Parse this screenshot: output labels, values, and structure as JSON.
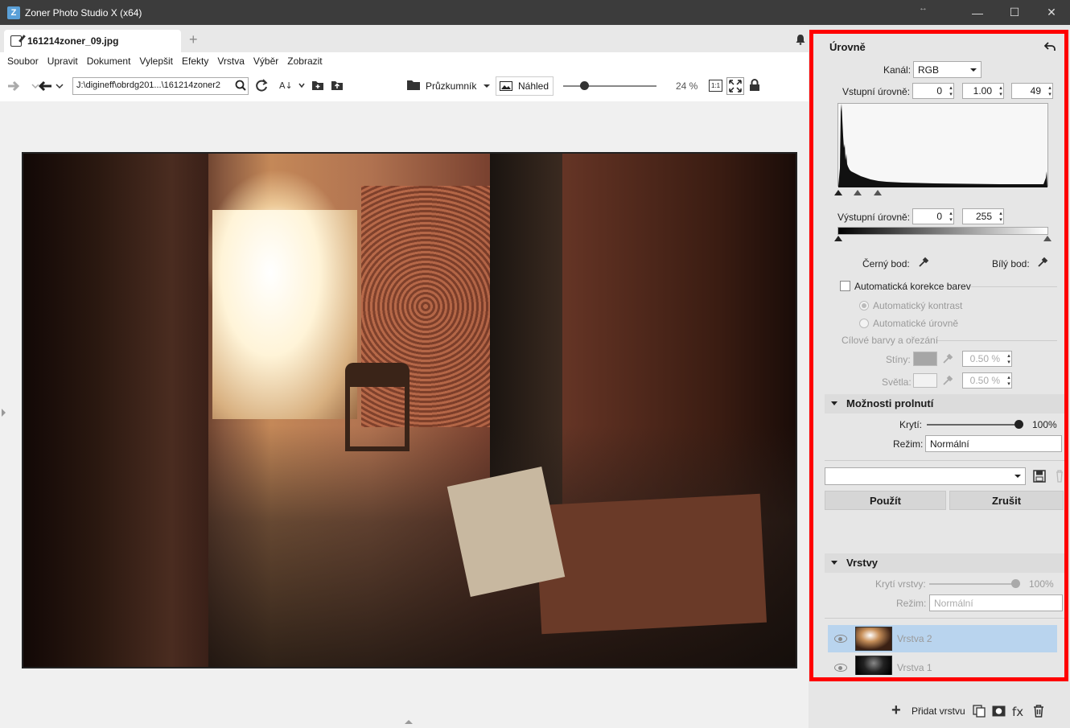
{
  "window": {
    "title": "Zoner Photo Studio X (x64)",
    "app_icon": "Z",
    "resize_glyph": "↔",
    "minimize": "—",
    "maximize": "☐",
    "close": "✕"
  },
  "tab": {
    "filename": "161214zoner_09.jpg",
    "new_tab": "+"
  },
  "menu": [
    "Soubor",
    "Upravit",
    "Dokument",
    "Vylepšit",
    "Efekty",
    "Vrstva",
    "Výběr",
    "Zobrazit"
  ],
  "toolbar": {
    "path": "J:\\digineff\\obrdg201...\\161214zoner2",
    "explorer_label": "Průzkumník",
    "preview_label": "Náhled",
    "zoom_level": "24 %",
    "zoom_fraction": 0.22,
    "one_to_one": "1:1"
  },
  "levels": {
    "title": "Úrovně",
    "channel_label": "Kanál:",
    "channel_value": "RGB",
    "input_label": "Vstupní úrovně:",
    "input_black": "0",
    "input_gamma": "1.00",
    "input_white": "49",
    "output_label": "Výstupní úrovně:",
    "output_black": "0",
    "output_white": "255",
    "black_point_label": "Černý bod:",
    "white_point_label": "Bílý bod:",
    "auto_color_label": "Automatická korekce barev",
    "auto_contrast_label": "Automatický kontrast",
    "auto_levels_label": "Automatické úrovně",
    "target_group_label": "Cílové barvy a ořezání",
    "shadows_label": "Stíny:",
    "shadows_value": "0.50 %",
    "highlights_label": "Světla:",
    "highlights_value": "0.50 %"
  },
  "blend": {
    "title": "Možnosti prolnutí",
    "opacity_label": "Krytí:",
    "opacity_value": "100%",
    "mode_label": "Režim:",
    "mode_value": "Normální"
  },
  "actions": {
    "apply": "Použít",
    "cancel": "Zrušit"
  },
  "layers": {
    "title": "Vrstvy",
    "opacity_label": "Krytí vrstvy:",
    "opacity_value": "100%",
    "mode_label": "Režim:",
    "mode_value": "Normální",
    "items": [
      {
        "name": "Vrstva 2",
        "selected": true
      },
      {
        "name": "Vrstva 1",
        "selected": false
      }
    ],
    "add_layer": "Přidat vrstvu",
    "add_glyph": "+"
  },
  "colors": {
    "highlight": "#ff0000",
    "selection": "#b9d4ee",
    "titlebar": "#3c3c3c"
  }
}
